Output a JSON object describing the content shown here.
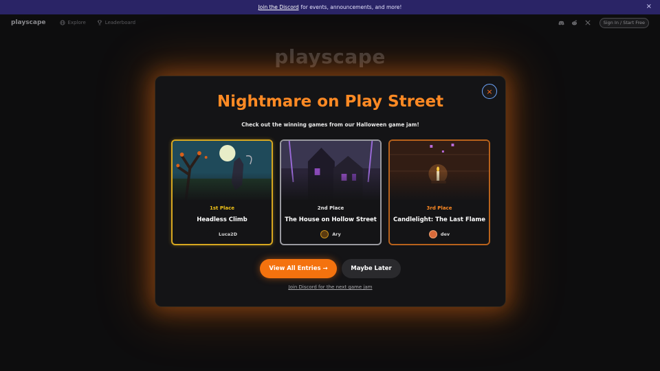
{
  "banner": {
    "link_text": "Join the Discord",
    "text": "for events, announcements, and more!",
    "close_glyph": "×"
  },
  "nav": {
    "logo": "playscape",
    "items": [
      {
        "label": "Explore",
        "icon": "globe-icon"
      },
      {
        "label": "Leaderboard",
        "icon": "trophy-icon"
      }
    ],
    "social_icons": [
      "discord-icon",
      "reddit-icon",
      "x-icon"
    ],
    "signin_label": "Sign In / Start Free"
  },
  "background_logo": "playscape",
  "modal": {
    "close_glyph": "×",
    "title": "Nightmare on Play Street",
    "subtitle": "Check out the winning games from our Halloween game jam!",
    "cards": [
      {
        "place": "1st Place",
        "title": "Headless Climb",
        "author": "Luca2D",
        "border_color": "#d8a820",
        "place_color": "#f2c418"
      },
      {
        "place": "2nd Place",
        "title": "The House on Hollow Street",
        "author": "Ary",
        "border_color": "#9a9aa0",
        "place_color": "#e8e8e8"
      },
      {
        "place": "3rd Place",
        "title": "Candlelight: The Last Flame",
        "author": "dev",
        "border_color": "#b8621c",
        "place_color": "#ff8a24"
      }
    ],
    "primary_button": "View All Entries →",
    "secondary_button": "Maybe Later",
    "discord_link": "Join Discord for the next game jam"
  },
  "colors": {
    "accent": "#f4720e",
    "title": "#ff8a24",
    "banner_bg": "#2a2466"
  }
}
